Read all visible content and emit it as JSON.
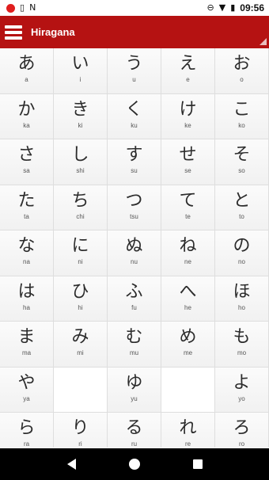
{
  "status_bar": {
    "time": "09:56",
    "left_icons": [
      "record-icon",
      "phone-icon",
      "notification-icon"
    ],
    "right_icons": [
      "sync-icon",
      "wifi-icon",
      "battery-icon"
    ]
  },
  "app_bar": {
    "title": "Hiragana",
    "menu_icon": "hamburger-menu-icon",
    "background": "#b51212"
  },
  "kana_rows": [
    [
      {
        "kana": "あ",
        "romaji": "a"
      },
      {
        "kana": "い",
        "romaji": "i"
      },
      {
        "kana": "う",
        "romaji": "u"
      },
      {
        "kana": "え",
        "romaji": "e"
      },
      {
        "kana": "お",
        "romaji": "o"
      }
    ],
    [
      {
        "kana": "か",
        "romaji": "ka"
      },
      {
        "kana": "き",
        "romaji": "ki"
      },
      {
        "kana": "く",
        "romaji": "ku"
      },
      {
        "kana": "け",
        "romaji": "ke"
      },
      {
        "kana": "こ",
        "romaji": "ko"
      }
    ],
    [
      {
        "kana": "さ",
        "romaji": "sa"
      },
      {
        "kana": "し",
        "romaji": "shi"
      },
      {
        "kana": "す",
        "romaji": "su"
      },
      {
        "kana": "せ",
        "romaji": "se"
      },
      {
        "kana": "そ",
        "romaji": "so"
      }
    ],
    [
      {
        "kana": "た",
        "romaji": "ta"
      },
      {
        "kana": "ち",
        "romaji": "chi"
      },
      {
        "kana": "つ",
        "romaji": "tsu"
      },
      {
        "kana": "て",
        "romaji": "te"
      },
      {
        "kana": "と",
        "romaji": "to"
      }
    ],
    [
      {
        "kana": "な",
        "romaji": "na"
      },
      {
        "kana": "に",
        "romaji": "ni"
      },
      {
        "kana": "ぬ",
        "romaji": "nu"
      },
      {
        "kana": "ね",
        "romaji": "ne"
      },
      {
        "kana": "の",
        "romaji": "no"
      }
    ],
    [
      {
        "kana": "は",
        "romaji": "ha"
      },
      {
        "kana": "ひ",
        "romaji": "hi"
      },
      {
        "kana": "ふ",
        "romaji": "fu"
      },
      {
        "kana": "へ",
        "romaji": "he"
      },
      {
        "kana": "ほ",
        "romaji": "ho"
      }
    ],
    [
      {
        "kana": "ま",
        "romaji": "ma"
      },
      {
        "kana": "み",
        "romaji": "mi"
      },
      {
        "kana": "む",
        "romaji": "mu"
      },
      {
        "kana": "め",
        "romaji": "me"
      },
      {
        "kana": "も",
        "romaji": "mo"
      }
    ],
    [
      {
        "kana": "や",
        "romaji": "ya"
      },
      null,
      {
        "kana": "ゆ",
        "romaji": "yu"
      },
      null,
      {
        "kana": "よ",
        "romaji": "yo"
      }
    ],
    [
      {
        "kana": "ら",
        "romaji": "ra"
      },
      {
        "kana": "り",
        "romaji": "ri"
      },
      {
        "kana": "る",
        "romaji": "ru"
      },
      {
        "kana": "れ",
        "romaji": "re"
      },
      {
        "kana": "ろ",
        "romaji": "ro"
      }
    ]
  ],
  "nav_bar": {
    "icons": [
      "back-icon",
      "home-icon",
      "recents-icon"
    ]
  }
}
